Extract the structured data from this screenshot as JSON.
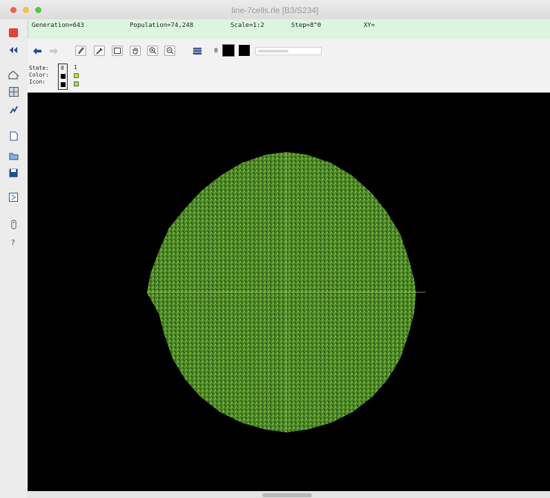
{
  "window": {
    "title": "line-7cells.rle [B3/S234]"
  },
  "status": {
    "generation": "Generation=643",
    "population": "Population=74,248",
    "scale": "Scale=1:2",
    "step": "Step=8^0",
    "xy": "XY="
  },
  "state_panel": {
    "state_label": "State:",
    "color_label": "Color:",
    "icon_label": "Icon:",
    "state_0": "0",
    "state_1": "1"
  },
  "toolbar": {
    "state_number": "0",
    "draw_state_color": "#000000",
    "slider_fraction": 0.5
  },
  "pattern": {
    "shape": "disc",
    "cell_color": "#5a9a2a",
    "background": "#000000"
  }
}
